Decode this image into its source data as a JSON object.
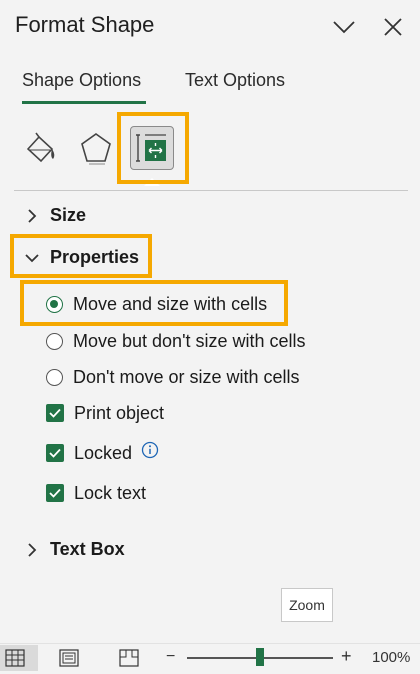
{
  "pane": {
    "title": "Format Shape"
  },
  "icons": {
    "collapse": "chevron-down-icon",
    "close": "close-icon",
    "fill_line": "paint-bucket-icon",
    "effects": "pentagon-icon",
    "size_properties": "size-properties-icon"
  },
  "tabs": [
    {
      "label": "Shape Options",
      "selected": true
    },
    {
      "label": "Text Options",
      "selected": false
    }
  ],
  "sections": {
    "size": {
      "label": "Size",
      "expanded": false
    },
    "properties": {
      "label": "Properties",
      "expanded": true
    },
    "text_box": {
      "label": "Text Box",
      "expanded": false
    }
  },
  "properties": {
    "positioning": [
      {
        "label": "Move and size with cells",
        "selected": true
      },
      {
        "label": "Move but don't size with cells",
        "selected": false
      },
      {
        "label": "Don't move or size with cells",
        "selected": false
      }
    ],
    "checkboxes": [
      {
        "label": "Print object",
        "checked": true
      },
      {
        "label": "Locked",
        "checked": true
      },
      {
        "label": "Lock text",
        "checked": true
      }
    ]
  },
  "zoom_button": {
    "label": "Zoom"
  },
  "status_bar": {
    "zoom_percent": "100%",
    "zoom_level": 100
  },
  "colors": {
    "accent": "#217346",
    "highlight": "#f5a800"
  }
}
